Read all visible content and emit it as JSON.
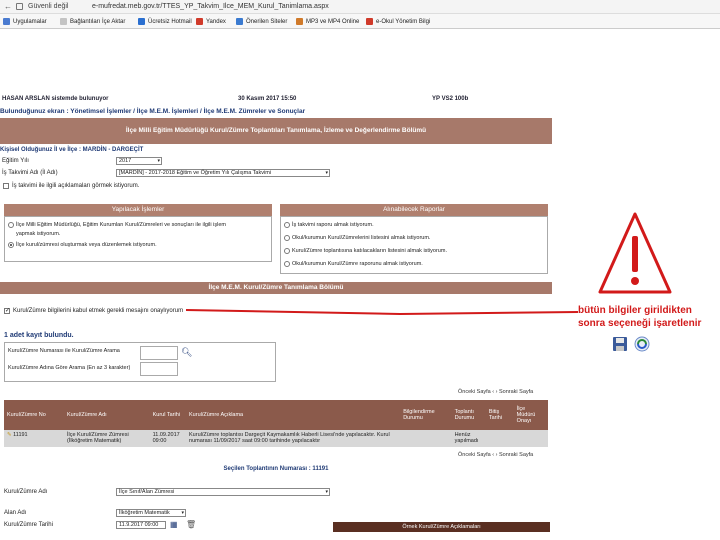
{
  "address_bar": {
    "security": "Güvenli değil",
    "url": "e-mufredat.meb.gov.tr/TTES_YP_Takvim_Ilce_MEM_Kurul_Tanimlama.aspx"
  },
  "bookmarks": [
    {
      "label": "Uygulamalar",
      "color": "#4a7bd0"
    },
    {
      "label": "Bağlantıları İçe Aktar",
      "color": "#c4c4c4"
    },
    {
      "label": "Ücretsiz Hotmail",
      "color": "#2a6fd0"
    },
    {
      "label": "Yandex",
      "color": "#d03a2a"
    },
    {
      "label": "Önerilen Siteler",
      "color": "#3a7ad0"
    },
    {
      "label": "MP3 ve MP4 Online",
      "color": "#d07a2a"
    },
    {
      "label": "e-Okul Yönetim Bilgi",
      "color": "#d03a2a"
    }
  ],
  "status": {
    "user": "HASAN ARSLAN sistemde bulunuyor",
    "date": "30 Kasım 2017 15:50",
    "version": "YP VS2 100b"
  },
  "location": "Bulunduğunuz ekran : Yönetimsel İşlemler / İlçe M.E.M. İşlemleri / İlçe M.E.M. Zümreler ve Sonuçlar",
  "main_header": "İlçe Milli Eğitim Müdürlüğü Kurul/Zümre Toplantıları Tanımlama, İzleme ve Değerlendirme Bölümü",
  "info": {
    "title": "Kişisel Olduğunuz İl ve İlçe : MARDİN - DARGEÇİT",
    "year_label": "Eğitim Yılı",
    "year_value": "2017",
    "schedule_label": "İş Takvimi Adı (İl Adı)",
    "schedule_value": "[MARDİN] - 2017-2018 Eğitim ve Öğretim Yılı Çalışma Takvimi",
    "see_steps_label": "İş takvimi ile ilgili açıklamaları görmek istiyorum."
  },
  "actions_box": {
    "title": "Yapılacak İşlemler",
    "options": [
      "İlçe Milli Eğitim Müdürlüğü, Eğitim Kurumları Kurul/Zümreleri ve sonuçları ile ilgili işlem",
      "İlçe kurul/zümresi oluşturmak veya düzenlemek istiyorum."
    ],
    "option1_cont": "yapmak istiyorum."
  },
  "reports_box": {
    "title": "Alınabilecek Raporlar",
    "options": [
      "İş takvimi raporu almak istiyorum.",
      "Okul/kurumun Kurul/Zümrelerini listesini almak istiyorum.",
      "Kurul/Zümre toplantısına katılacakların listesini almak istiyorum.",
      "Okul/kurumun Kurul/Zümre raporunu almak istiyorum."
    ]
  },
  "sub_header": "İlçe M.E.M. Kurul/Zümre Tanımlama Bölümü",
  "define_checkbox": "Kurul/Zümre bilgilerini kabul etmek gerekli mesajını onaylıyorum",
  "records_found": "1 adet kayıt bulundu.",
  "search": {
    "no_label": "Kurul/Zümre Numarası ile Kurul/Zümre Arama",
    "name_label": "Kurul/Zümre Adına Göre Arama (En az 3 karakter)"
  },
  "pager": {
    "prev": "Önceki Sayfa",
    "next": "Sonraki Sayfa"
  },
  "table": {
    "headers": [
      "Kurul/Zümre No",
      "Kurul/Zümre Adı",
      "Kurul Tarihi",
      "Kurul/Zümre Açıklama",
      "Bilgilendirme Durumu",
      "Toplantı Durumu",
      "Bitiş Tarihi",
      "İlçe Müdürü Onayı"
    ],
    "rows": [
      [
        "11191",
        "İlçe Kurul/Zümre Zümresi (İlköğretim Matematik)",
        "11.09.2017 09:00",
        "Kurul/Zümre toplantısı Dargeçit Kaymakamlık Haberli Lisesi'nde yapılacaktır. Kurul numarası 11/09/2017 saat 09:00 tarihinde yapılacaktır",
        "",
        "Henüz yapılmadı",
        "",
        ""
      ]
    ]
  },
  "selected_meeting": "Seçilen Toplantının Numarası : 11191",
  "bottom_form": {
    "kurul_label": "Kurul/Zümre Adı",
    "kurul_value": "İlçe Sınıf/Alan Zümresi",
    "alan_label": "Alan Adı",
    "alan_value": "İlköğretim Matematik",
    "tarih_label": "Kurul/Zümre Tarihi",
    "tarih_value": "11.9.2017 09:00",
    "example_bar": "Örnek Kurul/Zümre Açıklamaları"
  },
  "annotation": {
    "line1": "bütün bilgiler girildikten",
    "line2": "sonra seçeneği işaretlenir",
    "color": "#d21a1a"
  },
  "icons": [
    "save-icon",
    "refresh-icon"
  ]
}
